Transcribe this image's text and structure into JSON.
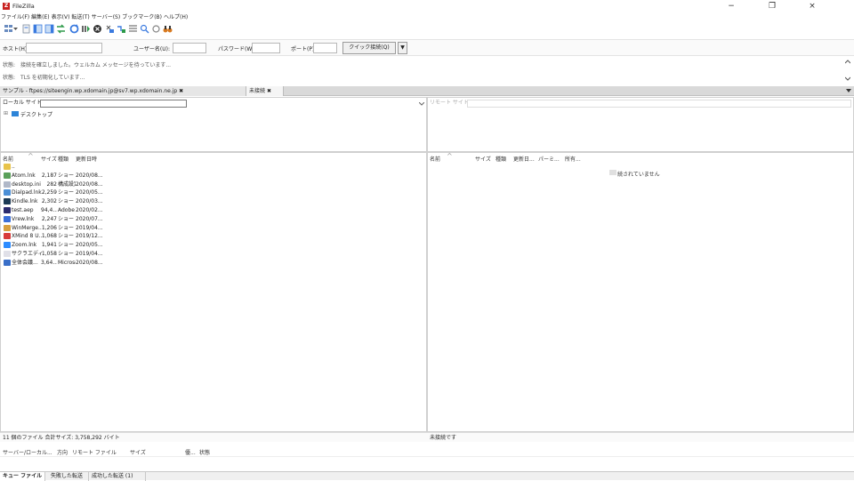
{
  "window": {
    "title": "FileZilla",
    "minimize": "−",
    "maximize": "❐",
    "close": "×"
  },
  "menu": [
    "ファイル(F)",
    "編集(E)",
    "表示(V)",
    "転送(T)",
    "サーバー(S)",
    "ブックマーク(B)",
    "ヘルプ(H)"
  ],
  "quickconnect": {
    "host_label": "ホスト(H):",
    "host_value": "",
    "user_label": "ユーザー名(U):",
    "user_value": "",
    "pass_label": "パスワード(W):",
    "pass_value": "",
    "port_label": "ポート(P):",
    "port_value": "",
    "button": "クイック接続(Q)",
    "dropdown": "▼"
  },
  "log": [
    {
      "key": "状態:",
      "text": "接続を確立しました。ウェルカム メッセージを待っています..."
    },
    {
      "key": "状態:",
      "text": "TLS を初期化しています..."
    }
  ],
  "tabs": [
    {
      "label": "サンプル - ftpes://siteengin.wp.xdomain.jp@sv7.wp.xdomain.ne.jp",
      "close": "✖"
    },
    {
      "label": "未接続",
      "close": "✖"
    }
  ],
  "local": {
    "site_label": "ローカル サイト:",
    "site_value": "",
    "tree_expand": "⊞",
    "tree_item": "デスクトップ",
    "columns": [
      "名前",
      "サイズ",
      "種類",
      "更新日時"
    ],
    "files": [
      {
        "name": "..",
        "size": "",
        "type": "",
        "date": "",
        "icon_color": "#e8c34a"
      },
      {
        "name": "Atom.lnk",
        "size": "2,187",
        "type": "ショートカ...",
        "date": "2020/08...",
        "icon_color": "#5aa05a"
      },
      {
        "name": "desktop.ini",
        "size": "282",
        "type": "構成設定",
        "date": "2020/08...",
        "icon_color": "#b0b8c8"
      },
      {
        "name": "Dialpad.lnk",
        "size": "2,259",
        "type": "ショートカ...",
        "date": "2020/05...",
        "icon_color": "#4b8fd6"
      },
      {
        "name": "Kindle.lnk",
        "size": "2,302",
        "type": "ショートカ...",
        "date": "2020/03...",
        "icon_color": "#1c3a54"
      },
      {
        "name": "test.aep",
        "size": "94,4...",
        "type": "Adobe A...",
        "date": "2020/02...",
        "icon_color": "#2b2b6e"
      },
      {
        "name": "Vrew.lnk",
        "size": "2,247",
        "type": "ショートカ...",
        "date": "2020/07...",
        "icon_color": "#3b6fd8"
      },
      {
        "name": "WinMerge...",
        "size": "1,206",
        "type": "ショートカ...",
        "date": "2019/04...",
        "icon_color": "#d8a040"
      },
      {
        "name": "XMind 8 U...",
        "size": "1,068",
        "type": "ショートカ...",
        "date": "2019/12...",
        "icon_color": "#d83a3a"
      },
      {
        "name": "Zoom.lnk",
        "size": "1,941",
        "type": "ショートカ...",
        "date": "2020/05...",
        "icon_color": "#2d8cff"
      },
      {
        "name": "サクラエディ...",
        "size": "1,058",
        "type": "ショートカ...",
        "date": "2019/04...",
        "icon_color": "#e0e0e8"
      },
      {
        "name": "全体会議...",
        "size": "3,64...",
        "type": "Microsof...",
        "date": "2020/08...",
        "icon_color": "#3a6fc8"
      }
    ],
    "status": "11 個のファイル 合計サイズ: 3,758,292 バイト"
  },
  "remote": {
    "site_label": "リモート サイト:",
    "columns": [
      "名前",
      "サイズ",
      "種類",
      "更新日...",
      "パーミ...",
      "所有..."
    ],
    "empty_message": "続されていません",
    "status": "未接続です"
  },
  "queue": {
    "columns": [
      "サーバー/ローカル...",
      "方向",
      "リモート ファイル",
      "サイズ",
      "優...",
      "状態"
    ],
    "tabs": [
      "キュー ファイル",
      "失敗した転送",
      "成功した転送 (1)"
    ]
  }
}
